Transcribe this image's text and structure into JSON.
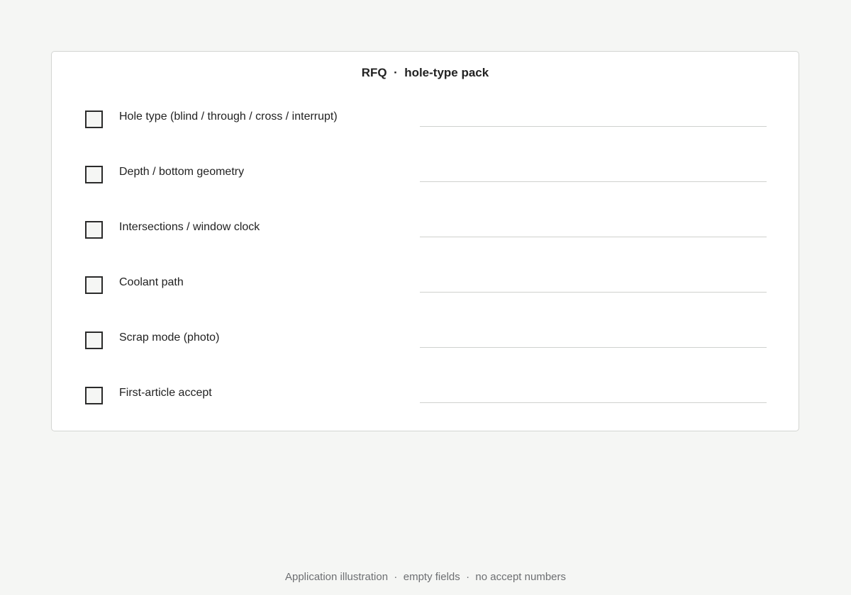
{
  "card": {
    "title": "RFQ  ·  hole-type pack"
  },
  "rows": [
    {
      "label": "Hole type (blind / through / cross / interrupt)",
      "value": "",
      "checked": false
    },
    {
      "label": "Depth / bottom geometry",
      "value": "",
      "checked": false
    },
    {
      "label": "Intersections / window clock",
      "value": "",
      "checked": false
    },
    {
      "label": "Coolant path",
      "value": "",
      "checked": false
    },
    {
      "label": "Scrap mode (photo)",
      "value": "",
      "checked": false
    },
    {
      "label": "First-article accept",
      "value": "",
      "checked": false
    }
  ],
  "footer": {
    "text": "Application illustration  ·  empty fields  ·  no accept numbers"
  },
  "colors": {
    "page_background": "#f5f6f4",
    "card_background": "#ffffff",
    "text": "#222222",
    "muted_text": "#6d6f72",
    "field_underline": "#cfd1ce"
  }
}
